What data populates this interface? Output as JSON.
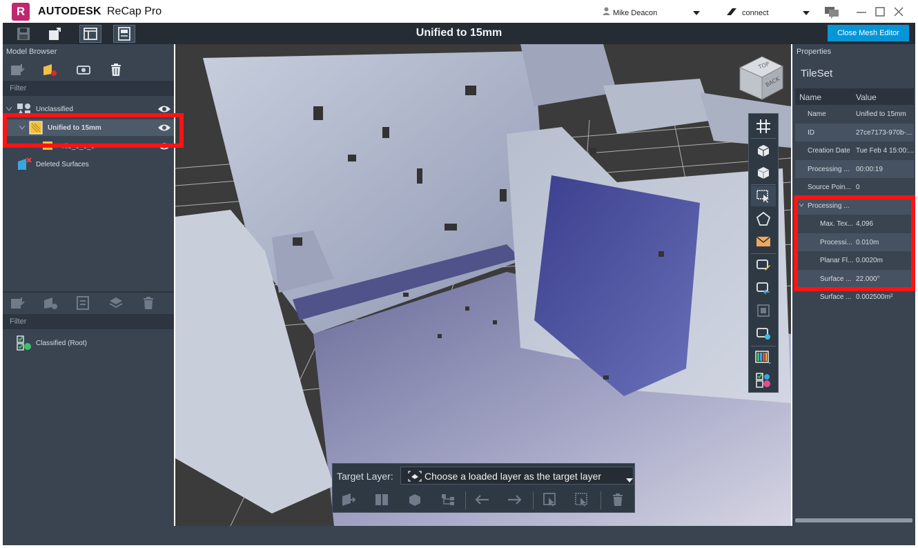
{
  "app": {
    "logo_letter": "R",
    "brand": "AUTODESK",
    "product": "ReCap Pro",
    "user": "Mike Deacon",
    "connect": "connect"
  },
  "toolbar": {
    "document_title": "Unified to 15mm",
    "close_mesh_editor": "Close Mesh Editor"
  },
  "model_browser": {
    "title": "Model Browser",
    "filter_label": "Filter",
    "items": [
      {
        "label": "Unclassified"
      },
      {
        "label": "Unified to 15mm"
      },
      {
        "label": "Tile_0_0_0"
      },
      {
        "label": "Deleted Surfaces"
      }
    ],
    "lower_filter_label": "Filter",
    "classified_root": "Classified (Root)"
  },
  "target_layer": {
    "label": "Target Layer:",
    "placeholder": "Choose a loaded layer as the target layer"
  },
  "viewcube": {
    "face_top": "TOP",
    "face_back": "BACK"
  },
  "properties": {
    "title": "Properties",
    "object_type": "TileSet",
    "columns": [
      "Name",
      "Value"
    ],
    "rows": [
      {
        "name": "Name",
        "value": "Unified to 15mm"
      },
      {
        "name": "ID",
        "value": "27ce7173-970b-..."
      },
      {
        "name": "Creation Date",
        "value": "Tue Feb 4 15:00:..."
      },
      {
        "name": "Processing ...",
        "value": "00:00:19"
      },
      {
        "name": "Source Poin...",
        "value": "0"
      },
      {
        "name": "Processing ...",
        "value": ""
      },
      {
        "name": "Max. Tex...",
        "value": "4,096"
      },
      {
        "name": "Processi...",
        "value": "0.010m"
      },
      {
        "name": "Planar Fl...",
        "value": "0.0020m"
      },
      {
        "name": "Surface ...",
        "value": "22.000°"
      },
      {
        "name": "Surface ...",
        "value": "0.002500m²"
      }
    ]
  },
  "colors": {
    "accent": "#0696d7",
    "highlight": "#ff1313",
    "panel": "#3a4451",
    "toolbar": "#252c34"
  }
}
